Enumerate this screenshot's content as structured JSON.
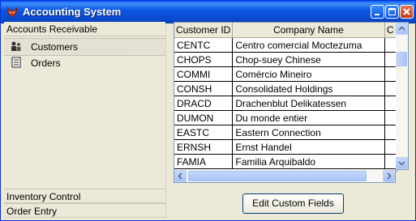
{
  "window": {
    "title": "Accounting System",
    "icon": "fox-app-icon",
    "controls": [
      "minimize-icon",
      "maximize-icon",
      "close-icon"
    ]
  },
  "sidebar": {
    "groups": [
      {
        "label": "Accounts Receivable",
        "items": [
          {
            "label": "Customers",
            "icon": "customers-icon",
            "selected": true
          },
          {
            "label": "Orders",
            "icon": "orders-icon",
            "selected": false
          }
        ]
      },
      {
        "label": "Inventory Control",
        "items": []
      },
      {
        "label": "Order Entry",
        "items": []
      }
    ]
  },
  "grid": {
    "columns": [
      "Customer ID",
      "Company Name",
      "C"
    ],
    "rows": [
      [
        "CENTC",
        "Centro comercial Moctezuma"
      ],
      [
        "CHOPS",
        "Chop-suey Chinese"
      ],
      [
        "COMMI",
        "Comércio Mineiro"
      ],
      [
        "CONSH",
        "Consolidated Holdings"
      ],
      [
        "DRACD",
        "Drachenblut Delikatessen"
      ],
      [
        "DUMON",
        "Du monde entier"
      ],
      [
        "EASTC",
        "Eastern Connection"
      ],
      [
        "ERNSH",
        "Ernst Handel"
      ],
      [
        "FAMIA",
        "Familia Arquibaldo"
      ]
    ]
  },
  "buttons": {
    "edit_custom_fields": "Edit Custom Fields"
  }
}
